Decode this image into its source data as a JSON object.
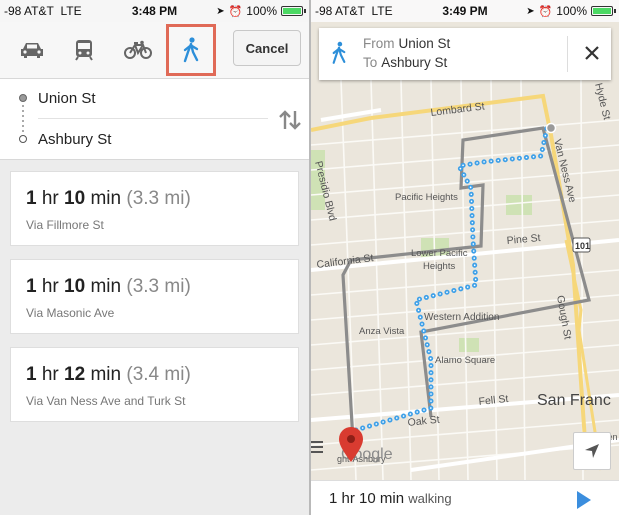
{
  "left_status": {
    "carrier": "-98 AT&T",
    "network": "LTE",
    "time": "3:48 PM",
    "battery": "100%"
  },
  "right_status": {
    "carrier": "-98 AT&T",
    "network": "LTE",
    "time": "3:49 PM",
    "battery": "100%"
  },
  "modes": {
    "items": [
      "car-icon",
      "transit-icon",
      "bike-icon",
      "walk-icon"
    ],
    "selected": "walk",
    "highlight_color": "#e06a57"
  },
  "cancel_label": "Cancel",
  "route_input": {
    "origin": "Union St",
    "destination": "Ashbury St"
  },
  "routes": [
    {
      "hr": "1",
      "hr_unit": "hr",
      "min": "10",
      "min_unit": "min",
      "distance": "(3.3 mi)",
      "via": "Via Fillmore St"
    },
    {
      "hr": "1",
      "hr_unit": "hr",
      "min": "10",
      "min_unit": "min",
      "distance": "(3.3 mi)",
      "via": "Via Masonic Ave"
    },
    {
      "hr": "1",
      "hr_unit": "hr",
      "min": "12",
      "min_unit": "min",
      "distance": "(3.4 mi)",
      "via": "Via Van Ness Ave and Turk St"
    }
  ],
  "directions": {
    "from_label": "From",
    "from": "Union St",
    "to_label": "To",
    "to": "Ashbury St"
  },
  "map": {
    "labels": {
      "lombard": "Lombard St",
      "van_ness": "Van Ness Ave",
      "hyde": "Hyde St",
      "presidio": "Presidio Blvd",
      "pacific_heights": "Pacific Heights",
      "pine": "Pine St",
      "california": "California St",
      "lower_pacific_1": "Lower Pacific",
      "lower_pacific_2": "Heights",
      "highway": "101",
      "western_addition": "Western Addition",
      "gough": "Gough St",
      "anza_vista": "Anza Vista",
      "alamo_square": "Alamo Square",
      "fell": "Fell St",
      "san_francisco": "San Franc",
      "oak": "Oak St",
      "google": "Google",
      "haight": "ght-Ashbury",
      "civic": "Cen"
    },
    "route_color": "#3ea0e8",
    "alt_route_color": "#8c8c8c",
    "pin_color": "#d93b30"
  },
  "bottom": {
    "duration": "1 hr 10 min",
    "mode": "walking"
  }
}
